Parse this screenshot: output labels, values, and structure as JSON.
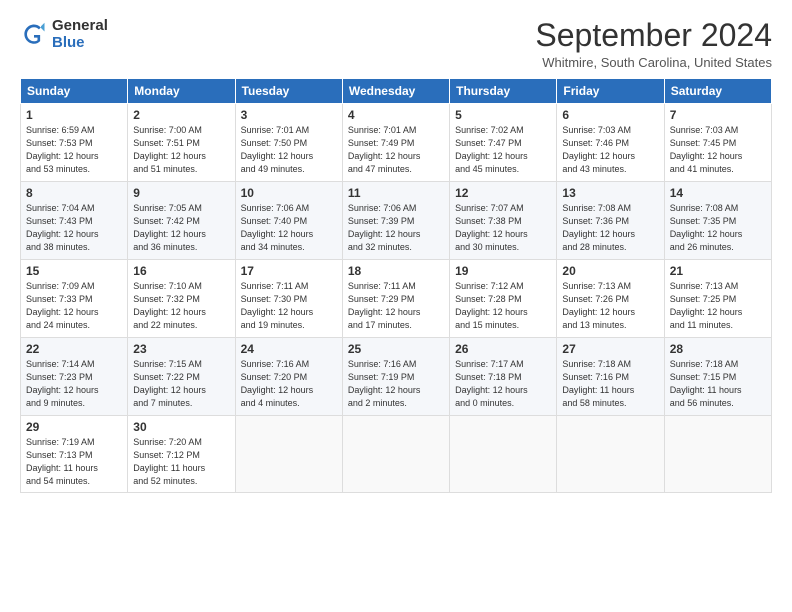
{
  "logo": {
    "line1": "General",
    "line2": "Blue"
  },
  "title": "September 2024",
  "location": "Whitmire, South Carolina, United States",
  "weekdays": [
    "Sunday",
    "Monday",
    "Tuesday",
    "Wednesday",
    "Thursday",
    "Friday",
    "Saturday"
  ],
  "weeks": [
    [
      {
        "day": "1",
        "info": "Sunrise: 6:59 AM\nSunset: 7:53 PM\nDaylight: 12 hours\nand 53 minutes."
      },
      {
        "day": "2",
        "info": "Sunrise: 7:00 AM\nSunset: 7:51 PM\nDaylight: 12 hours\nand 51 minutes."
      },
      {
        "day": "3",
        "info": "Sunrise: 7:01 AM\nSunset: 7:50 PM\nDaylight: 12 hours\nand 49 minutes."
      },
      {
        "day": "4",
        "info": "Sunrise: 7:01 AM\nSunset: 7:49 PM\nDaylight: 12 hours\nand 47 minutes."
      },
      {
        "day": "5",
        "info": "Sunrise: 7:02 AM\nSunset: 7:47 PM\nDaylight: 12 hours\nand 45 minutes."
      },
      {
        "day": "6",
        "info": "Sunrise: 7:03 AM\nSunset: 7:46 PM\nDaylight: 12 hours\nand 43 minutes."
      },
      {
        "day": "7",
        "info": "Sunrise: 7:03 AM\nSunset: 7:45 PM\nDaylight: 12 hours\nand 41 minutes."
      }
    ],
    [
      {
        "day": "8",
        "info": "Sunrise: 7:04 AM\nSunset: 7:43 PM\nDaylight: 12 hours\nand 38 minutes."
      },
      {
        "day": "9",
        "info": "Sunrise: 7:05 AM\nSunset: 7:42 PM\nDaylight: 12 hours\nand 36 minutes."
      },
      {
        "day": "10",
        "info": "Sunrise: 7:06 AM\nSunset: 7:40 PM\nDaylight: 12 hours\nand 34 minutes."
      },
      {
        "day": "11",
        "info": "Sunrise: 7:06 AM\nSunset: 7:39 PM\nDaylight: 12 hours\nand 32 minutes."
      },
      {
        "day": "12",
        "info": "Sunrise: 7:07 AM\nSunset: 7:38 PM\nDaylight: 12 hours\nand 30 minutes."
      },
      {
        "day": "13",
        "info": "Sunrise: 7:08 AM\nSunset: 7:36 PM\nDaylight: 12 hours\nand 28 minutes."
      },
      {
        "day": "14",
        "info": "Sunrise: 7:08 AM\nSunset: 7:35 PM\nDaylight: 12 hours\nand 26 minutes."
      }
    ],
    [
      {
        "day": "15",
        "info": "Sunrise: 7:09 AM\nSunset: 7:33 PM\nDaylight: 12 hours\nand 24 minutes."
      },
      {
        "day": "16",
        "info": "Sunrise: 7:10 AM\nSunset: 7:32 PM\nDaylight: 12 hours\nand 22 minutes."
      },
      {
        "day": "17",
        "info": "Sunrise: 7:11 AM\nSunset: 7:30 PM\nDaylight: 12 hours\nand 19 minutes."
      },
      {
        "day": "18",
        "info": "Sunrise: 7:11 AM\nSunset: 7:29 PM\nDaylight: 12 hours\nand 17 minutes."
      },
      {
        "day": "19",
        "info": "Sunrise: 7:12 AM\nSunset: 7:28 PM\nDaylight: 12 hours\nand 15 minutes."
      },
      {
        "day": "20",
        "info": "Sunrise: 7:13 AM\nSunset: 7:26 PM\nDaylight: 12 hours\nand 13 minutes."
      },
      {
        "day": "21",
        "info": "Sunrise: 7:13 AM\nSunset: 7:25 PM\nDaylight: 12 hours\nand 11 minutes."
      }
    ],
    [
      {
        "day": "22",
        "info": "Sunrise: 7:14 AM\nSunset: 7:23 PM\nDaylight: 12 hours\nand 9 minutes."
      },
      {
        "day": "23",
        "info": "Sunrise: 7:15 AM\nSunset: 7:22 PM\nDaylight: 12 hours\nand 7 minutes."
      },
      {
        "day": "24",
        "info": "Sunrise: 7:16 AM\nSunset: 7:20 PM\nDaylight: 12 hours\nand 4 minutes."
      },
      {
        "day": "25",
        "info": "Sunrise: 7:16 AM\nSunset: 7:19 PM\nDaylight: 12 hours\nand 2 minutes."
      },
      {
        "day": "26",
        "info": "Sunrise: 7:17 AM\nSunset: 7:18 PM\nDaylight: 12 hours\nand 0 minutes."
      },
      {
        "day": "27",
        "info": "Sunrise: 7:18 AM\nSunset: 7:16 PM\nDaylight: 11 hours\nand 58 minutes."
      },
      {
        "day": "28",
        "info": "Sunrise: 7:18 AM\nSunset: 7:15 PM\nDaylight: 11 hours\nand 56 minutes."
      }
    ],
    [
      {
        "day": "29",
        "info": "Sunrise: 7:19 AM\nSunset: 7:13 PM\nDaylight: 11 hours\nand 54 minutes."
      },
      {
        "day": "30",
        "info": "Sunrise: 7:20 AM\nSunset: 7:12 PM\nDaylight: 11 hours\nand 52 minutes."
      },
      {
        "day": "",
        "info": ""
      },
      {
        "day": "",
        "info": ""
      },
      {
        "day": "",
        "info": ""
      },
      {
        "day": "",
        "info": ""
      },
      {
        "day": "",
        "info": ""
      }
    ]
  ]
}
